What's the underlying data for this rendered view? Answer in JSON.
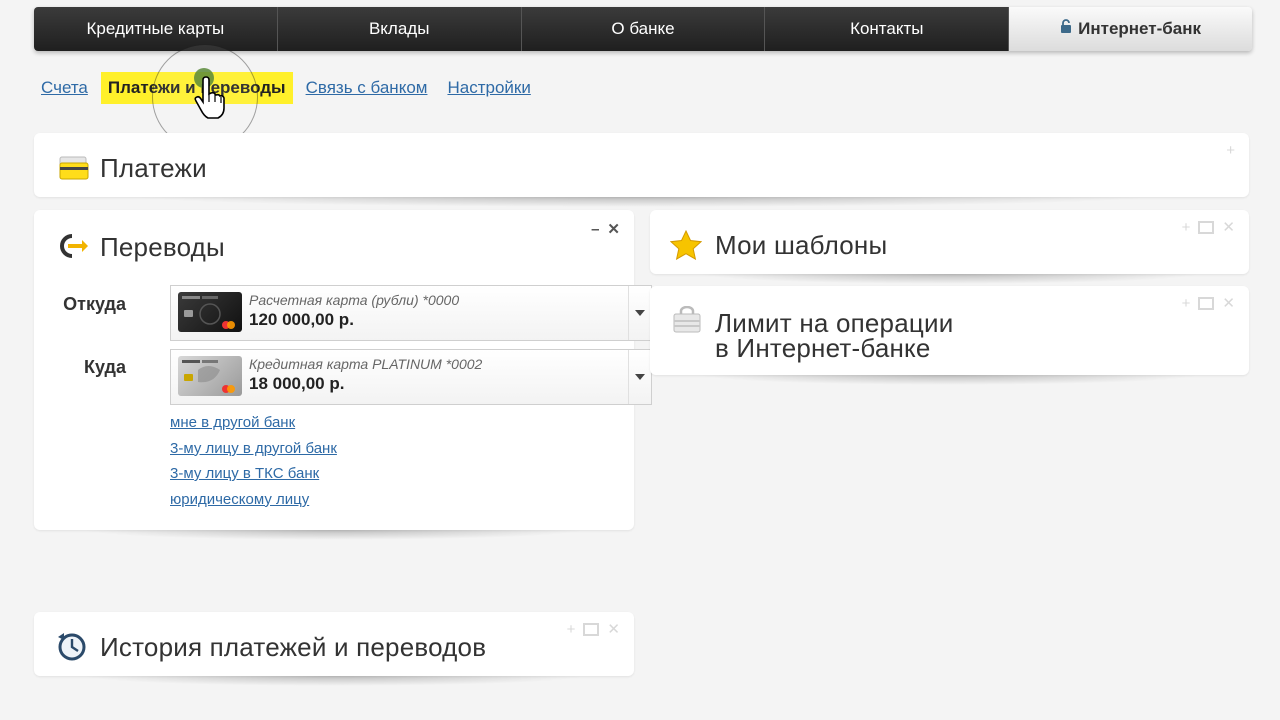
{
  "topnav": {
    "tabs": [
      {
        "label": "Кредитные карты"
      },
      {
        "label": "Вклады"
      },
      {
        "label": "О банке"
      },
      {
        "label": "Контакты"
      },
      {
        "label": "Интернет-банк"
      }
    ]
  },
  "subnav": {
    "items": [
      {
        "label": "Счета"
      },
      {
        "label": "Платежи и переводы"
      },
      {
        "label": "Связь с банком"
      },
      {
        "label": "Настройки"
      }
    ]
  },
  "panels": {
    "payments": {
      "title": "Платежи"
    },
    "transfers": {
      "title": "Переводы",
      "from_label": "Откуда",
      "to_label": "Куда",
      "from_card": {
        "name": "Расчетная карта (рубли) *0000",
        "amount": "120 000,00 р."
      },
      "to_card": {
        "name": "Кредитная карта PLATINUM *0002",
        "amount": "18 000,00 р."
      },
      "links": [
        "мне в другой банк",
        "3-му лицу в другой банк",
        "3-му лицу в ТКС банк",
        "юридическому лицу"
      ]
    },
    "templates": {
      "title": "Мои шаблоны"
    },
    "limit": {
      "title_line1": "Лимит на операции",
      "title_line2": "в Интернет-банке"
    },
    "history": {
      "title": "История платежей и переводов"
    }
  },
  "colors": {
    "highlight": "#fff02a",
    "link": "#2e6aa6",
    "nav_dark": "#2a2a2a"
  },
  "icons": [
    "lock-icon",
    "card-icon",
    "transfer-icon",
    "star-icon",
    "lock-case-icon",
    "clock-icon",
    "hand-cursor-icon"
  ]
}
